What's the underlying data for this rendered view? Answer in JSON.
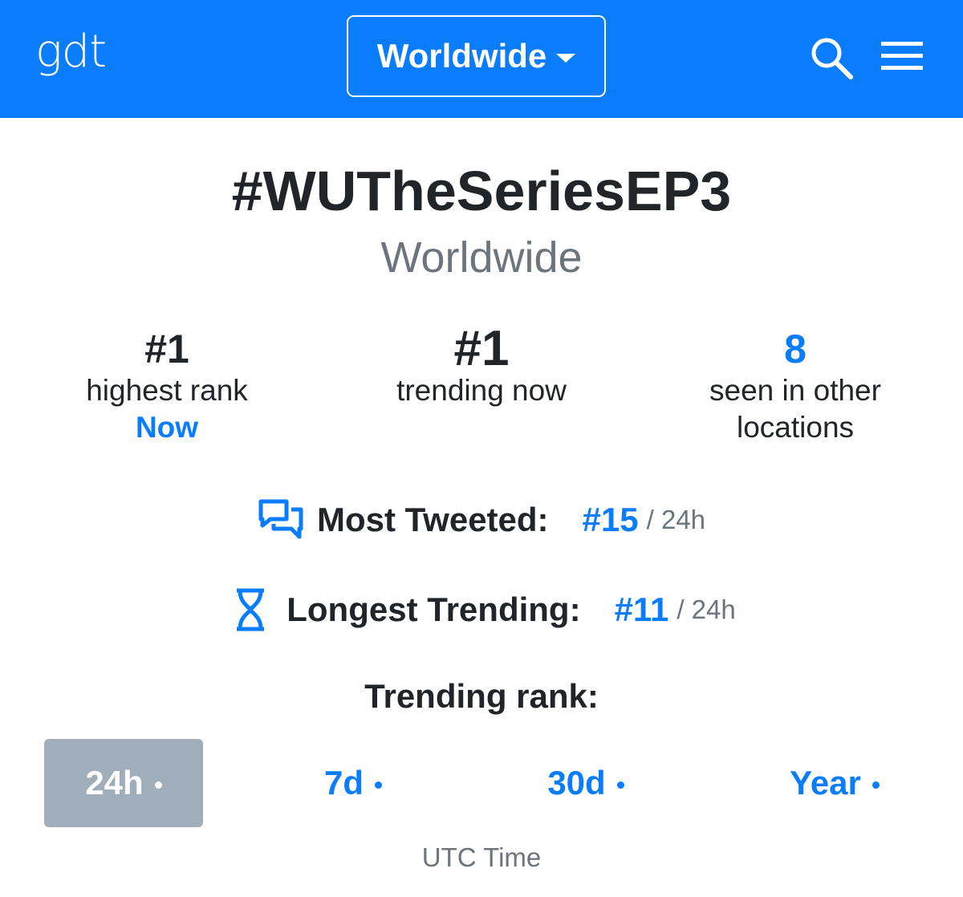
{
  "header": {
    "logo": "gdt",
    "location_button": "Worldwide"
  },
  "trend": {
    "hashtag": "#WUTheSeriesEP3",
    "location": "Worldwide"
  },
  "stats": {
    "highest_rank": {
      "value": "#1",
      "label": "highest rank",
      "when": "Now"
    },
    "trending_now": {
      "value": "#1",
      "label": "trending now"
    },
    "other_locations": {
      "value": "8",
      "label_line1": "seen in other",
      "label_line2": "locations"
    }
  },
  "most_tweeted": {
    "label": "Most Tweeted:",
    "rank": "#15",
    "period": "/ 24h"
  },
  "longest_trending": {
    "label": "Longest Trending:",
    "rank": "#11",
    "period": "/ 24h"
  },
  "trending_rank": {
    "title": "Trending rank:",
    "tabs": [
      {
        "label": "24h",
        "active": true
      },
      {
        "label": "7d",
        "active": false
      },
      {
        "label": "30d",
        "active": false
      },
      {
        "label": "Year",
        "active": false
      }
    ],
    "footer": "UTC Time"
  },
  "colors": {
    "brand_blue": "#0a7cfe",
    "text_dark": "#212529",
    "text_muted": "#6c757d",
    "active_tab_bg": "#a0adbb"
  }
}
